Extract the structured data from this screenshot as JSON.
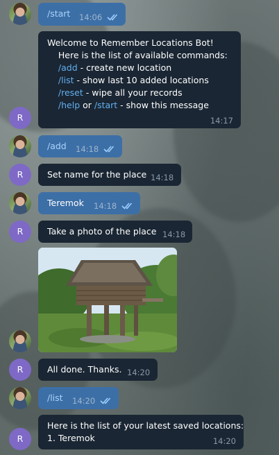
{
  "messages": {
    "m1": {
      "text": "/start",
      "time": "14:06"
    },
    "m2": {
      "lines": [
        {
          "text": "Welcome to Remember Locations Bot!"
        },
        {
          "text": "    Here is the list of available commands:"
        },
        {
          "text": ""
        },
        {
          "cmd": "/add",
          "rest": " - create new location"
        },
        {
          "cmd": "/list",
          "rest": " - show last 10 added locations"
        },
        {
          "cmd": "/reset",
          "rest": " - wipe all your records"
        },
        {
          "cmd": "/help",
          "mid": " or ",
          "cmd2": "/start",
          "rest": " - show this message"
        }
      ],
      "time": "14:17"
    },
    "m3": {
      "text": "/add",
      "time": "14:18"
    },
    "m4": {
      "text": "Set name for the place",
      "time": "14:18"
    },
    "m5": {
      "text": "Teremok",
      "time": "14:18"
    },
    "m6": {
      "text": "Take a photo of the place",
      "time": "14:18"
    },
    "m8": {
      "text": "All done. Thanks.",
      "time": "14:20"
    },
    "m9": {
      "text": "/list",
      "time": "14:20"
    },
    "m10": {
      "line1": "Here is the list of your latest saved locations:",
      "line2": "1. Teremok",
      "time": "14:20"
    }
  },
  "bot_avatar_letter": "R",
  "colors": {
    "outgoing": "#3d6fa7",
    "incoming": "#1a2633",
    "command": "#63aff0",
    "bot_avatar": "#7e69c7"
  },
  "icons": {
    "read_receipt": "double-check-icon"
  }
}
